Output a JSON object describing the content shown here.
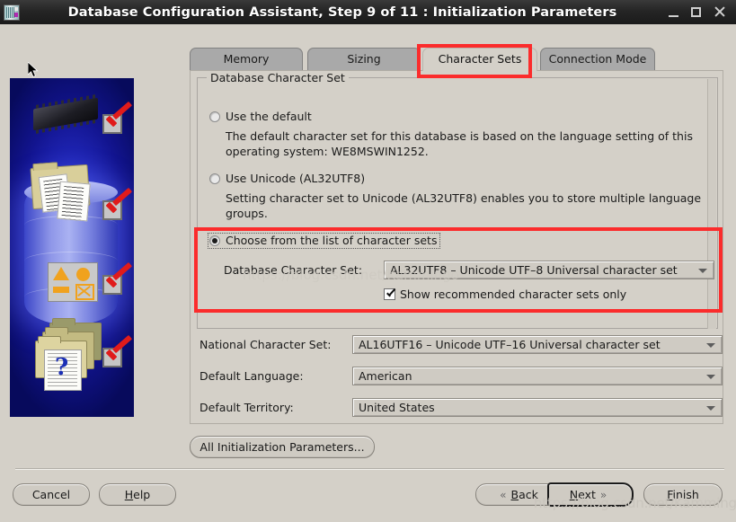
{
  "window": {
    "title": "Database Configuration Assistant, Step 9 of 11 : Initialization Parameters",
    "icon": "database-app-icon",
    "controls": {
      "minimize": "minimize-icon",
      "maximize": "maximize-icon",
      "close": "close-icon"
    }
  },
  "sidebar": {
    "alt": "oracle-dbca-progress-graphic",
    "steps": [
      {
        "icon": "memory-chip-icon",
        "checked": true
      },
      {
        "icon": "documents-folder-icon",
        "checked": true
      },
      {
        "icon": "shapes-palette-icon",
        "checked": true
      },
      {
        "icon": "folders-question-icon",
        "checked": true
      }
    ]
  },
  "tabs": [
    {
      "id": "memory",
      "label": "Memory",
      "selected": false
    },
    {
      "id": "sizing",
      "label": "Sizing",
      "selected": false
    },
    {
      "id": "character-sets",
      "label": "Character Sets",
      "selected": true
    },
    {
      "id": "connection-mode",
      "label": "Connection Mode",
      "selected": false
    }
  ],
  "group": {
    "title": "Database Character Set",
    "options": [
      {
        "id": "use-default",
        "label": "Use the default",
        "selected": false,
        "description": "The default character set for this database is based on the language setting of this operating system: WE8MSWIN1252."
      },
      {
        "id": "use-unicode",
        "label": "Use Unicode (AL32UTF8)",
        "selected": false,
        "description": "Setting character set to Unicode (AL32UTF8) enables you to store multiple language groups."
      },
      {
        "id": "choose-from-list",
        "label": "Choose from the list of character sets",
        "selected": true,
        "focused": true
      }
    ],
    "db_charset": {
      "label": "Database Character Set:",
      "value": "AL32UTF8 – Unicode UTF–8 Universal character set"
    },
    "show_recommended": {
      "label": "Show recommended character sets only",
      "checked": true
    }
  },
  "fields": [
    {
      "id": "national-character-set",
      "label": "National Character Set:",
      "value": "AL16UTF16 – Unicode UTF–16 Universal character set"
    },
    {
      "id": "default-language",
      "label": "Default Language:",
      "value": "American"
    },
    {
      "id": "default-territory",
      "label": "Default Territory:",
      "value": "United States"
    }
  ],
  "buttons": {
    "all_init_params": "All Initialization Parameters...",
    "cancel": "Cancel",
    "help": "Help",
    "back": "Back",
    "next": "Next",
    "finish": "Finish",
    "back_icon": "«",
    "next_icon": "»"
  },
  "watermark": "https://blog.csdn.net/Kammingo",
  "colors": {
    "titlebar": "#252525",
    "window_bg": "#d4d0c8",
    "highlight": "#fb2c2c",
    "tab_inactive": "#a9a9a9",
    "sidebar_blue": "#1b22b0",
    "check_red": "#e01b1b"
  }
}
